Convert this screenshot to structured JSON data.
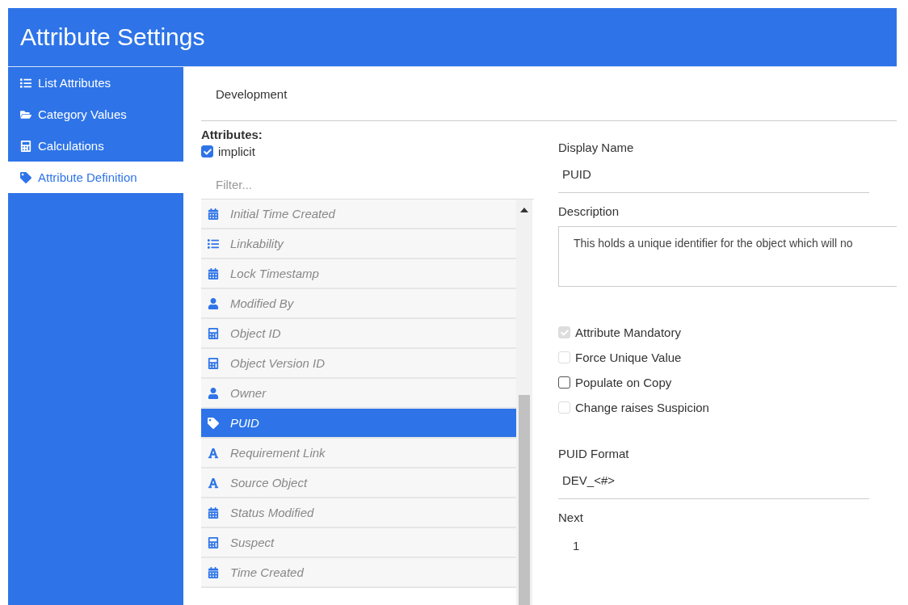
{
  "window": {
    "title": "Attribute Settings"
  },
  "sidebar": {
    "items": [
      {
        "label": "List Attributes",
        "kind": "list",
        "selected": false
      },
      {
        "label": "Category Values",
        "kind": "folder",
        "selected": false
      },
      {
        "label": "Calculations",
        "kind": "calculator",
        "selected": false
      },
      {
        "label": "Attribute Definition",
        "kind": "tag",
        "selected": true
      }
    ]
  },
  "breadcrumb": "Development",
  "attributes": {
    "heading": "Attributes:",
    "implicit": {
      "label": "implicit",
      "checked": true
    },
    "filter": {
      "placeholder": "Filter..."
    },
    "items": [
      {
        "label": "Initial Time Created",
        "kind": "date",
        "selected": false
      },
      {
        "label": "Linkability",
        "kind": "list",
        "selected": false
      },
      {
        "label": "Lock Timestamp",
        "kind": "date",
        "selected": false
      },
      {
        "label": "Modified By",
        "kind": "user",
        "selected": false
      },
      {
        "label": "Object ID",
        "kind": "number",
        "selected": false
      },
      {
        "label": "Object Version ID",
        "kind": "number",
        "selected": false
      },
      {
        "label": "Owner",
        "kind": "user",
        "selected": false
      },
      {
        "label": "PUID",
        "kind": "tag",
        "selected": true
      },
      {
        "label": "Requirement Link",
        "kind": "text",
        "selected": false
      },
      {
        "label": "Source Object",
        "kind": "text",
        "selected": false
      },
      {
        "label": "Status Modified",
        "kind": "date",
        "selected": false
      },
      {
        "label": "Suspect",
        "kind": "number",
        "selected": false
      },
      {
        "label": "Time Created",
        "kind": "date",
        "selected": false
      }
    ]
  },
  "details": {
    "display_name": {
      "label": "Display Name",
      "value": "PUID"
    },
    "description": {
      "label": "Description",
      "value": "This holds a unique identifier for the object which will no"
    },
    "options": [
      {
        "label": "Attribute Mandatory",
        "checked": true,
        "disabled": true
      },
      {
        "label": "Force Unique Value",
        "checked": false,
        "disabled": true
      },
      {
        "label": "Populate on Copy",
        "checked": false,
        "disabled": false
      },
      {
        "label": "Change raises Suspicion",
        "checked": false,
        "disabled": true
      }
    ],
    "puid_format": {
      "label": "PUID Format",
      "value": "DEV_<#>"
    },
    "next": {
      "label": "Next",
      "value": "1"
    }
  }
}
